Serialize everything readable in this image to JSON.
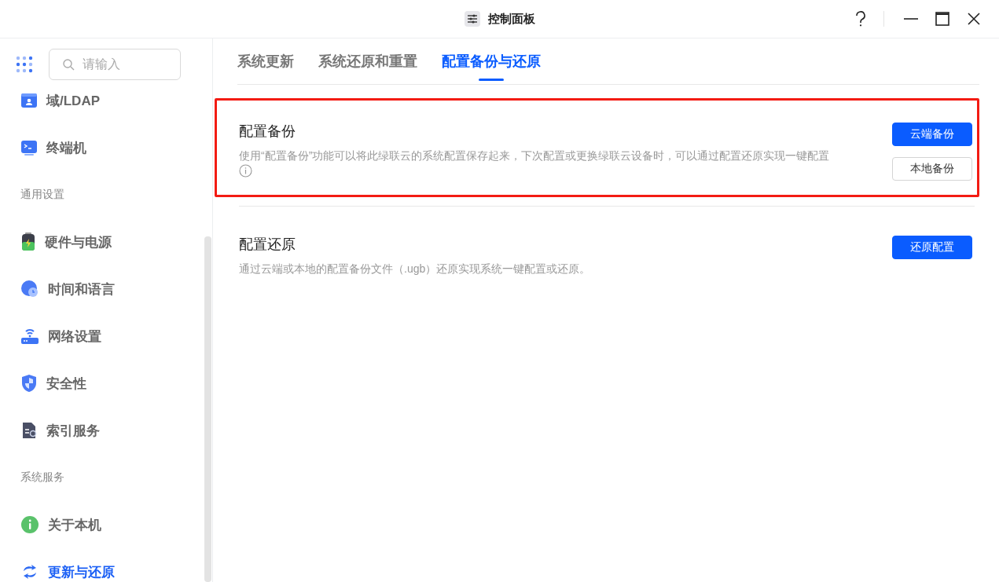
{
  "window": {
    "title": "控制面板"
  },
  "search": {
    "placeholder": "请输入"
  },
  "sidebar": {
    "items": [
      {
        "kind": "item",
        "label": "域/LDAP",
        "selected": false
      },
      {
        "kind": "item",
        "label": "终端机",
        "selected": false
      },
      {
        "kind": "header",
        "label": "通用设置"
      },
      {
        "kind": "item",
        "label": "硬件与电源",
        "selected": false
      },
      {
        "kind": "item",
        "label": "时间和语言",
        "selected": false
      },
      {
        "kind": "item",
        "label": "网络设置",
        "selected": false
      },
      {
        "kind": "item",
        "label": "安全性",
        "selected": false
      },
      {
        "kind": "item",
        "label": "索引服务",
        "selected": false
      },
      {
        "kind": "header",
        "label": "系统服务"
      },
      {
        "kind": "item",
        "label": "关于本机",
        "selected": false
      },
      {
        "kind": "item",
        "label": "更新与还原",
        "selected": true
      }
    ]
  },
  "tabs": [
    {
      "label": "系统更新",
      "selected": false
    },
    {
      "label": "系统还原和重置",
      "selected": false
    },
    {
      "label": "配置备份与还原",
      "selected": true
    }
  ],
  "sections": [
    {
      "title": "配置备份",
      "description": "使用“配置备份”功能可以将此绿联云的系统配置保存起来，下次配置或更换绿联云设备时，可以通过配置还原实现一键配置",
      "info": true,
      "highlighted": true,
      "buttons": [
        {
          "label": "云端备份",
          "kind": "primary"
        },
        {
          "label": "本地备份",
          "kind": "default"
        }
      ]
    },
    {
      "title": "配置还原",
      "description": "通过云端或本地的配置备份文件（.ugb）还原实现系统一键配置或还原。",
      "info": false,
      "highlighted": false,
      "buttons": [
        {
          "label": "还原配置",
          "kind": "primary"
        }
      ]
    }
  ]
}
